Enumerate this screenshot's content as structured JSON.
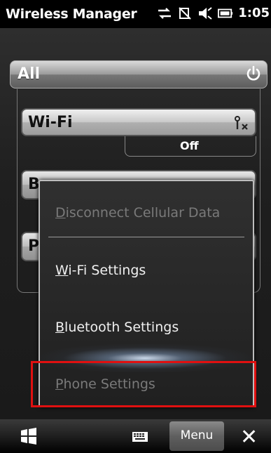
{
  "status_bar": {
    "title": "Wireless Manager",
    "time": "1:05"
  },
  "all_bar": {
    "label": "All"
  },
  "radios": {
    "wifi": {
      "label": "Wi-Fi",
      "status": "Off"
    },
    "bluetooth": {
      "label_visible": "B"
    },
    "phone": {
      "label_visible": "P"
    }
  },
  "menu": {
    "items": [
      {
        "label_prefix": "",
        "mnemonic": "D",
        "label_rest": "isconnect Cellular Data",
        "enabled": false
      },
      {
        "label_prefix": "",
        "mnemonic": "W",
        "label_rest": "i-Fi Settings",
        "enabled": true
      },
      {
        "label_prefix": "",
        "mnemonic": "B",
        "label_rest": "luetooth Settings",
        "enabled": true
      },
      {
        "label_prefix": "",
        "mnemonic": "P",
        "label_rest": "hone Settings",
        "enabled": false
      }
    ]
  },
  "softkeys": {
    "menu_label": "Menu"
  },
  "colors": {
    "highlight": "#e01010"
  }
}
